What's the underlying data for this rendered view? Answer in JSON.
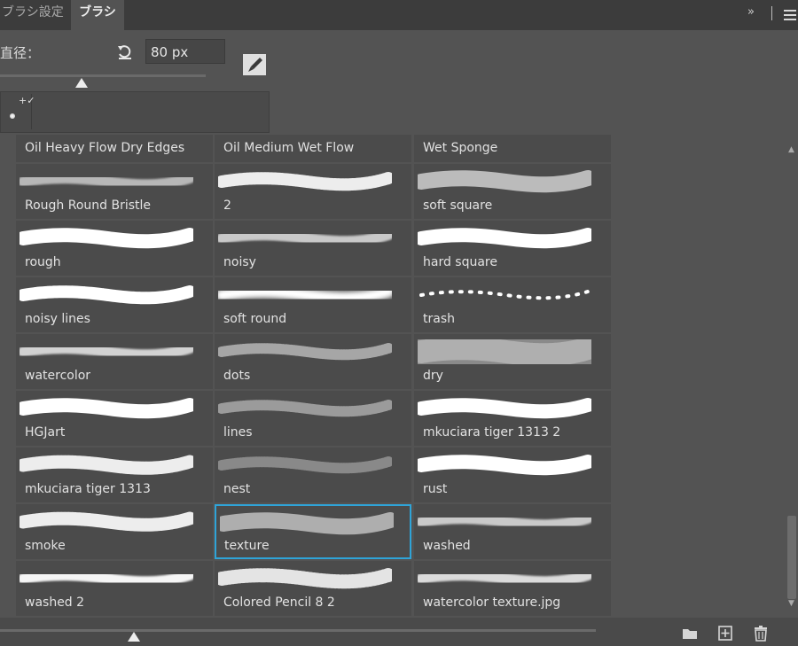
{
  "tabs": [
    {
      "label": "ブラシ設定",
      "active": false
    },
    {
      "label": "ブラシ",
      "active": true
    }
  ],
  "header_icons": {
    "collapse": "»",
    "menu": "hamburger-menu-icon"
  },
  "size": {
    "label": "直径：",
    "value": "80 px",
    "slider_fraction": 0.4
  },
  "brushes": [
    {
      "name": "Oil Heavy Flow Dry Edges"
    },
    {
      "name": "Oil Medium Wet Flow"
    },
    {
      "name": "Wet Sponge"
    },
    {
      "name": "Rough Round Bristle"
    },
    {
      "name": "2"
    },
    {
      "name": "soft square"
    },
    {
      "name": "rough"
    },
    {
      "name": "noisy"
    },
    {
      "name": "hard square"
    },
    {
      "name": "noisy lines"
    },
    {
      "name": "soft round"
    },
    {
      "name": "trash"
    },
    {
      "name": "watercolor"
    },
    {
      "name": "dots"
    },
    {
      "name": "dry"
    },
    {
      "name": "HGJart"
    },
    {
      "name": "lines"
    },
    {
      "name": "mkuciara tiger 1313 2"
    },
    {
      "name": "mkuciara tiger 1313"
    },
    {
      "name": "nest"
    },
    {
      "name": "rust"
    },
    {
      "name": "smoke"
    },
    {
      "name": "texture",
      "selected": true
    },
    {
      "name": "washed"
    },
    {
      "name": "washed 2"
    },
    {
      "name": "Colored Pencil 8 2"
    },
    {
      "name": "watercolor texture.jpg"
    }
  ],
  "colors": {
    "panel_bg": "#535353",
    "tab_bar": "#3c3c3c",
    "selection": "#2fa4d8"
  },
  "preview_zoom_fraction": 0.22
}
